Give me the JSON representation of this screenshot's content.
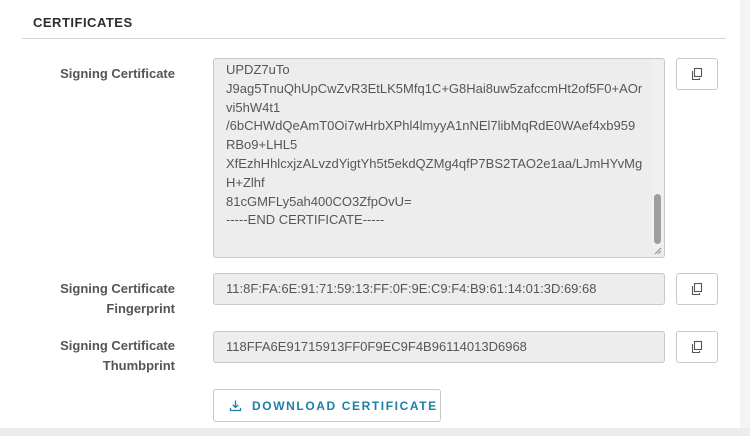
{
  "section": {
    "title": "CERTIFICATES"
  },
  "signing_certificate": {
    "label": "Signing Certificate",
    "top_cut_line": "",
    "lines": [
      "UPDZ7uTo",
      "J9ag5TnuQhUpCwZvR3EtLK5Mfq1C+G8Hai8uw5zafccmHt2of5F0+AOr",
      "vi5hW4t1",
      "/6bCHWdQeAmT0Oi7wHrbXPhl4lmyyA1nNEl7libMqRdE0WAef4xb959",
      "RBo9+LHL5",
      "XfEzhHhlcxjzALvzdYigtYh5t5ekdQZMg4qfP7BS2TAO2e1aa/LJmHYvMg",
      "H+Zlhf",
      "81cGMFLy5ah400CO3ZfpOvU=",
      "-----END CERTIFICATE-----"
    ]
  },
  "fingerprint": {
    "label_line1": "Signing Certificate",
    "label_line2": "Fingerprint",
    "value": "11:8F:FA:6E:91:71:59:13:FF:0F:9E:C9:F4:B9:61:14:01:3D:69:68"
  },
  "thumbprint": {
    "label_line1": "Signing Certificate",
    "label_line2": "Thumbprint",
    "value": "118FFA6E91715913FF0F9EC9F4B96114013D6968"
  },
  "download": {
    "label": "DOWNLOAD CERTIFICATE"
  },
  "icons": {
    "copy": "copy-icon",
    "download": "download-icon"
  },
  "colors": {
    "accent": "#1d7fa8",
    "field_bg": "#ededed",
    "border": "#c9c9c9"
  }
}
